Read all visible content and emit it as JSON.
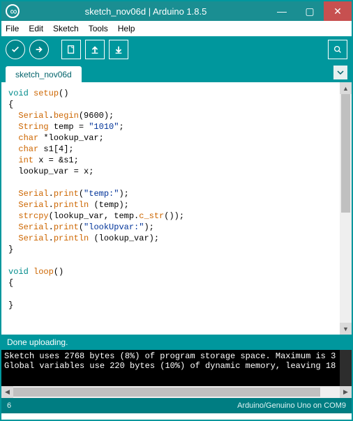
{
  "window": {
    "title": "sketch_nov06d | Arduino 1.8.5"
  },
  "menubar": {
    "items": [
      "File",
      "Edit",
      "Sketch",
      "Tools",
      "Help"
    ]
  },
  "tabs": {
    "active": "sketch_nov06d"
  },
  "code": {
    "tokens": [
      {
        "t": "kw",
        "v": "void"
      },
      {
        "t": "p",
        "v": " "
      },
      {
        "t": "func",
        "v": "setup"
      },
      {
        "t": "p",
        "v": "()\n{\n  "
      },
      {
        "t": "type",
        "v": "Serial"
      },
      {
        "t": "p",
        "v": "."
      },
      {
        "t": "func",
        "v": "begin"
      },
      {
        "t": "p",
        "v": "(9600);\n  "
      },
      {
        "t": "type",
        "v": "String"
      },
      {
        "t": "p",
        "v": " temp = "
      },
      {
        "t": "str",
        "v": "\"1010\""
      },
      {
        "t": "p",
        "v": ";\n  "
      },
      {
        "t": "type",
        "v": "char"
      },
      {
        "t": "p",
        "v": " *lookup_var;\n  "
      },
      {
        "t": "type",
        "v": "char"
      },
      {
        "t": "p",
        "v": " s1[4];\n  "
      },
      {
        "t": "type",
        "v": "int"
      },
      {
        "t": "p",
        "v": " x = &s1;\n  lookup_var = x;\n\n  "
      },
      {
        "t": "type",
        "v": "Serial"
      },
      {
        "t": "p",
        "v": "."
      },
      {
        "t": "func",
        "v": "print"
      },
      {
        "t": "p",
        "v": "("
      },
      {
        "t": "str",
        "v": "\"temp:\""
      },
      {
        "t": "p",
        "v": ");\n  "
      },
      {
        "t": "type",
        "v": "Serial"
      },
      {
        "t": "p",
        "v": "."
      },
      {
        "t": "func",
        "v": "println"
      },
      {
        "t": "p",
        "v": " (temp);\n  "
      },
      {
        "t": "func",
        "v": "strcpy"
      },
      {
        "t": "p",
        "v": "(lookup_var, temp."
      },
      {
        "t": "func",
        "v": "c_str"
      },
      {
        "t": "p",
        "v": "());\n  "
      },
      {
        "t": "type",
        "v": "Serial"
      },
      {
        "t": "p",
        "v": "."
      },
      {
        "t": "func",
        "v": "print"
      },
      {
        "t": "p",
        "v": "("
      },
      {
        "t": "str",
        "v": "\"lookUpvar:\""
      },
      {
        "t": "p",
        "v": ");\n  "
      },
      {
        "t": "type",
        "v": "Serial"
      },
      {
        "t": "p",
        "v": "."
      },
      {
        "t": "func",
        "v": "println"
      },
      {
        "t": "p",
        "v": " (lookup_var);\n}\n\n"
      },
      {
        "t": "kw",
        "v": "void"
      },
      {
        "t": "p",
        "v": " "
      },
      {
        "t": "func",
        "v": "loop"
      },
      {
        "t": "p",
        "v": "()\n{\n\n}"
      }
    ]
  },
  "status": {
    "message": "Done uploading."
  },
  "console": {
    "lines": [
      "Sketch uses 2768 bytes (8%) of program storage space. Maximum is 3",
      "Global variables use 220 bytes (10%) of dynamic memory, leaving 18"
    ]
  },
  "footer": {
    "left": "6",
    "right": "Arduino/Genuino Uno on COM9"
  }
}
